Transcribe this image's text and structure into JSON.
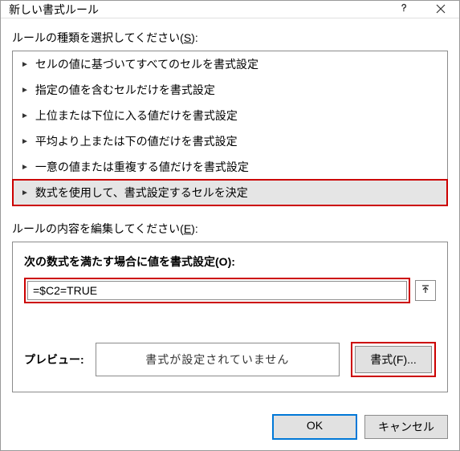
{
  "titlebar": {
    "title": "新しい書式ルール"
  },
  "ruleTypeSection": {
    "label": "ルールの種類を選択してください(",
    "shortcut": "S",
    "labelEnd": "):",
    "items": [
      {
        "text": "セルの値に基づいてすべてのセルを書式設定"
      },
      {
        "text": "指定の値を含むセルだけを書式設定"
      },
      {
        "text": "上位または下位に入る値だけを書式設定"
      },
      {
        "text": "平均より上または下の値だけを書式設定"
      },
      {
        "text": "一意の値または重複する値だけを書式設定"
      },
      {
        "text": "数式を使用して、書式設定するセルを決定"
      }
    ]
  },
  "editSection": {
    "label": "ルールの内容を編集してください(",
    "shortcut": "E",
    "labelEnd": "):",
    "formulaLabel": "次の数式を満たす場合に値を書式設定(",
    "formulaShortcut": "O",
    "formulaLabelEnd": "):",
    "formulaValue": "=$C2=TRUE",
    "previewLabel": "プレビュー:",
    "previewText": "書式が設定されていません",
    "formatBtnPrefix": "書式(",
    "formatShortcut": "F",
    "formatBtnSuffix": ")..."
  },
  "buttons": {
    "ok": "OK",
    "cancel": "キャンセル"
  }
}
